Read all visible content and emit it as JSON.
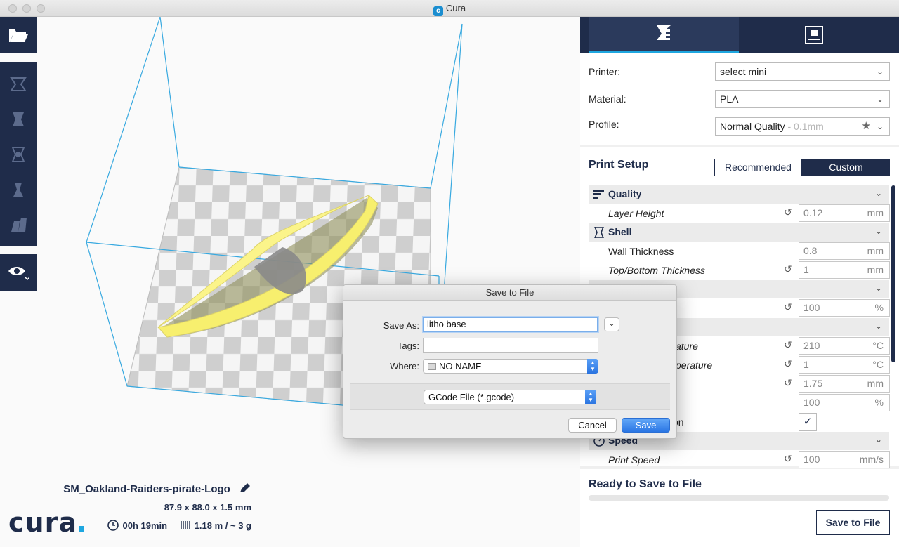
{
  "window": {
    "title": "Cura"
  },
  "toolbar": {
    "open_icon": "folder-open-icon",
    "tools": [
      "translate-icon",
      "scale-icon",
      "rotate-icon",
      "mirror-icon",
      "per-model-settings-icon"
    ],
    "view_icon": "eye-icon"
  },
  "brand": {
    "logo_text": "cura",
    "logo_dot_color": "#1ea7e0"
  },
  "model": {
    "name": "SM_Oakland-Raiders-pirate-Logo",
    "dimensions": "87.9 x 88.0 x 1.5 mm",
    "print_time": "00h 19min",
    "material_usage": "1.18 m / ~ 3 g"
  },
  "panel": {
    "tabs": [
      "print-settings-icon",
      "monitor-icon"
    ],
    "printer_label": "Printer:",
    "printer_value": "select mini",
    "material_label": "Material:",
    "material_value": "PLA",
    "profile_label": "Profile:",
    "profile_value": "Normal Quality",
    "profile_suffix": " - 0.1mm",
    "setup_title": "Print Setup",
    "mode_recommended": "Recommended",
    "mode_custom": "Custom",
    "categories": {
      "quality": "Quality",
      "shell": "Shell",
      "speed": "Speed"
    },
    "settings": {
      "layer_height": {
        "label": "Layer Height",
        "value": "0.12",
        "unit": "mm"
      },
      "wall_thickness": {
        "label": "Wall Thickness",
        "value": "0.8",
        "unit": "mm"
      },
      "top_bottom": {
        "label": "Top/Bottom Thickness",
        "value": "1",
        "unit": "mm"
      },
      "infill": {
        "value": "100",
        "unit": "%"
      },
      "print_temp": {
        "label_tail": "ature",
        "value": "210",
        "unit": "°C"
      },
      "bed_temp": {
        "label_tail": "perature",
        "value": "1",
        "unit": "°C"
      },
      "diameter": {
        "value": "1.75",
        "unit": "mm"
      },
      "flow": {
        "value": "100",
        "unit": "%"
      },
      "retraction": {
        "label_tail": "on",
        "checked": true,
        "mark": "✓"
      },
      "print_speed": {
        "label": "Print Speed",
        "value": "100",
        "unit": "mm/s"
      }
    },
    "ready_text": "Ready to Save to File",
    "save_button": "Save to File"
  },
  "dialog": {
    "title": "Save to File",
    "save_as_label": "Save As:",
    "save_as_value": "litho base",
    "tags_label": "Tags:",
    "tags_value": "",
    "where_label": "Where:",
    "where_value": "NO NAME",
    "format_value": "GCode File (*.gcode)",
    "cancel_label": "Cancel",
    "save_label": "Save"
  },
  "colors": {
    "navy": "#1f2c4a",
    "accent": "#1ea7e0",
    "model": "#f7ef6e",
    "box_lines": "#38a9e0"
  }
}
